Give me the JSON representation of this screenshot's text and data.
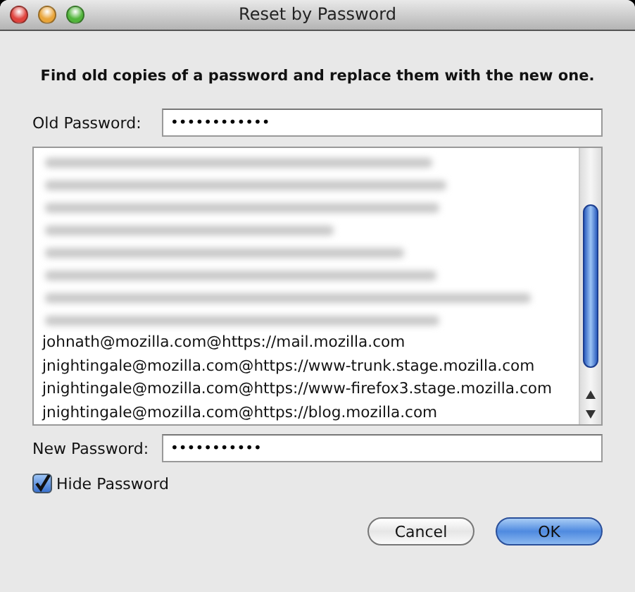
{
  "window": {
    "title": "Reset by Password"
  },
  "instruction": "Find old copies of a password and replace them with the new one.",
  "old_password": {
    "label": "Old Password:",
    "value": "••••••••••••"
  },
  "entries": [
    {
      "kind": "blurred"
    },
    {
      "kind": "blurred"
    },
    {
      "kind": "blurred"
    },
    {
      "kind": "blurred"
    },
    {
      "kind": "blurred"
    },
    {
      "kind": "blurred"
    },
    {
      "kind": "blurred"
    },
    {
      "kind": "blurred"
    },
    {
      "kind": "entry",
      "text": "johnath@mozilla.com@https://mail.mozilla.com"
    },
    {
      "kind": "entry",
      "text": "jnightingale@mozilla.com@https://www-trunk.stage.mozilla.com"
    },
    {
      "kind": "entry",
      "text": "jnightingale@mozilla.com@https://www-firefox3.stage.mozilla.com"
    },
    {
      "kind": "entry",
      "text": "jnightingale@mozilla.com@https://blog.mozilla.com"
    }
  ],
  "new_password": {
    "label": "New Password:",
    "value": "•••••••••••"
  },
  "hide_password": {
    "label": "Hide Password",
    "checked": true
  },
  "buttons": [
    {
      "label": "Cancel",
      "kind": "cancel"
    },
    {
      "label": "OK",
      "kind": "default"
    }
  ]
}
